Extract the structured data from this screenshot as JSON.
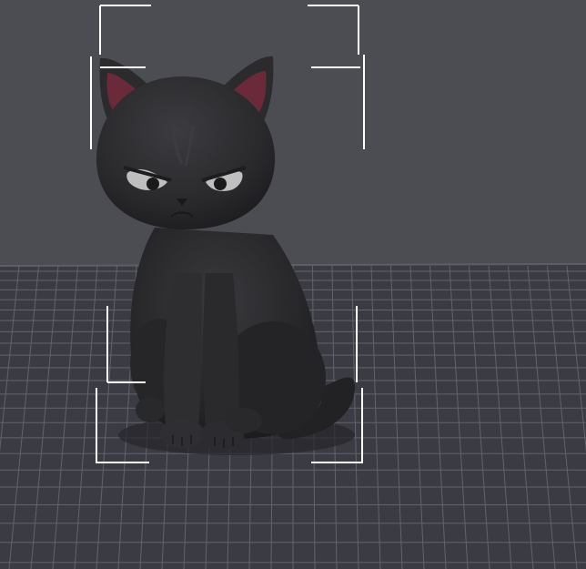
{
  "viewport": {
    "background_color": "#4c4c53",
    "bed_color": "#3a3a42",
    "grid_color": "#6a6a73",
    "model_color": "#2b2b2e",
    "inner_ear_color": "#6b2a3a",
    "eye_color": "#bfbfbf",
    "selection_bracket_color": "#ffffff",
    "object": {
      "name": "black-cat-figurine",
      "selected": true
    }
  }
}
